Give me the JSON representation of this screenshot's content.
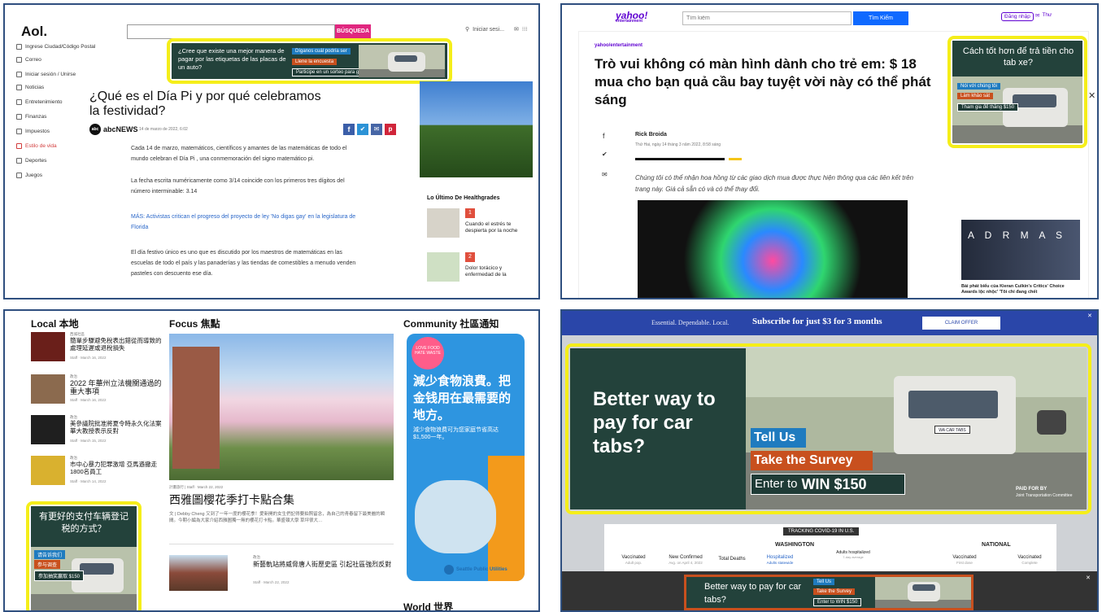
{
  "aol": {
    "logo": "Aol.",
    "search_button": "BÚSQUEDA",
    "signin": "Iniciar sesi...",
    "sidebar": [
      "Ingrese Ciudad/Código Postal",
      "Correo",
      "Iniciar sesión / Unirse",
      "Noticias",
      "Entretenimiento",
      "Finanzas",
      "Impuestos",
      "Estilo de vida",
      "Deportes",
      "Juegos"
    ],
    "ad_question": "¿Cree que existe una mejor manera de pagar por las etiquetas de las placas de un auto?",
    "ad_btn1": "Díganos cuál podría ser",
    "ad_btn2": "Llene la encuesta",
    "ad_btn3": "Participe en un sorteo para ganar $150",
    "headline": "¿Qué es el Día Pi y por qué celebramos la festividad?",
    "source": "abcNEWS",
    "date": "14 de marzo de 2022, 6:02",
    "p1": "Cada 14 de marzo, matemáticos, científicos y amantes de las matemáticas de todo el mundo celebran el Día Pi , una conmemoración del signo matemático pi.",
    "p2": "La fecha escrita numéricamente como 3/14 coincide con los primeros tres dígitos del número interminable: 3.14",
    "p3": "MÁS: Activistas critican el progreso del proyecto de ley 'No digas gay' en la legislatura de Florida",
    "p4": "El día festivo único es uno que es discutido por los maestros de matemáticas en las escuelas de todo el país y las panaderías y las tiendas de comestibles a menudo venden pasteles con descuento ese día.",
    "latest_title": "Lo Último De Healthgrades",
    "latest": [
      {
        "n": "1",
        "t": "Cuando el estrés te despierta por la noche"
      },
      {
        "n": "2",
        "t": "Dolor torácico y enfermedad de la"
      }
    ]
  },
  "yahoo": {
    "logo": "yahoo!",
    "logo_sub": "entertainment",
    "search_placeholder": "Tìm kiếm",
    "search_button": "Tìm Kiếm",
    "signin": "Đăng nhập",
    "mail": "Thư",
    "section": "yahoo/entertainment",
    "headline": "Trò vui không có màn hình dành cho trẻ em: $ 18 mua cho bạn quả cầu bay tuyệt vời này có thể phát sáng",
    "author": "Rick Broida",
    "date": "Thứ Hai, ngày 14 tháng 3 năm 2022, 8:58 sáng",
    "disclaimer": "Chúng tôi có thể nhận hoa hồng từ các giao dịch mua được thực hiện thông qua các liên kết trên trang này. Giá cả sẵn có và có thể thay đổi.",
    "ad_title": "Cách tốt hơn để trả tiền cho tab xe?",
    "ad_btn1": "Nói với chúng tôi",
    "ad_btn2": "Làm khảo sát",
    "ad_btn3": "Tham gia để thắng $150",
    "side_caption": "Bài phát biểu của Kieran Culkin's Critics' Choice Awards lộc nhộc' 'Tôi chỉ đang chết",
    "side_img_text": "A D R M A S"
  },
  "chinese": {
    "local_title": "Local 本地",
    "focus_title": "Focus 焦點",
    "community_title": "Community 社區通知",
    "world_title": "World 世界",
    "local_items": [
      {
        "k": "西城社區",
        "t": "簡單步驟避免稅表出錯從而導致的處理延遲或退稅損失",
        "m": "Staff · March 16, 2022"
      },
      {
        "k": "政治",
        "t": "2022 年華州立法機關通過的重大事項",
        "m": "Staff · March 16, 2022"
      },
      {
        "k": "政治",
        "t": "美參議院批准將夏令時永久化法案 華大教授表示反對",
        "m": "Staff · March 15, 2022"
      },
      {
        "k": "政治",
        "t": "市中心暴力犯罪激增 亞馬遜撤走1800名員工",
        "m": "Staff · March 14, 2022"
      }
    ],
    "ad_title": "有更好的支付车辆登记税的方式？",
    "ad_btn1": "请告诉我们",
    "ad_btn2": "参与调查",
    "ad_btn3": "参加抽奖赢取 $150",
    "focus_meta": "計畫旅行 | Staff · March 22, 2022",
    "focus_headline": "西雅圖櫻花季打卡點合集",
    "focus_excerpt": "文 | Debby Cheng 又到了一年一度的櫻花季！愛新開的女生們記得要拍照留念，為自己的青春留下最美麗的瞬間。今期小編為大家介紹西雅圖獨一無的櫻花打卡點。華盛頓大學 草坪很大…",
    "second_kicker": "政治",
    "second_title": "新藝軌站將威脅唐人街歷史區 引起社區強烈反對",
    "second_meta": "Staff · March 22, 2022",
    "community_ad_big": "減少食物浪費。把金钱用在最需要的地方。",
    "community_ad_small": "減少食物浪费可为您家庭节省高达$1,500一年。",
    "community_ad_brand": "Seattle Public Utilities",
    "community_ad_badge": "LOVE FOOD HATE WASTE"
  },
  "localnews": {
    "banner_left": "Essential. Dependable. Local.",
    "banner_main": "Subscribe for just $3 for 3 months",
    "banner_button": "CLAIM OFFER",
    "ad_headline": "Better way to pay for car tabs?",
    "ad_btn1": "Tell Us",
    "ad_btn2": "Take the Survey",
    "ad_btn3_prefix": "Enter to",
    "ad_btn3_win": "WIN $150",
    "paid_for": "PAID FOR BY",
    "committee": "Joint Transportation Committee",
    "plate": "WA CAR TABS",
    "covid_title": "TRACKING COVID-19 IN U.S.",
    "washington": "WASHINGTON",
    "national": "NATIONAL",
    "cols": [
      "Vaccinated",
      "New Confirmed",
      "Total Deaths",
      "Hospitalized",
      "Adults hospitalized",
      "Vaccinated",
      "Vaccinated"
    ],
    "subcols": [
      "Adult pop.",
      "Avg. on April 4, 2022",
      "",
      "Adults statewide",
      "7-day average",
      "First dose",
      "Complete"
    ],
    "bottom_ad": "Better way to pay for car tabs?",
    "bottom_btn1": "Tell Us",
    "bottom_btn2": "Take the Survey",
    "bottom_btn3": "Enter to WIN $150"
  }
}
